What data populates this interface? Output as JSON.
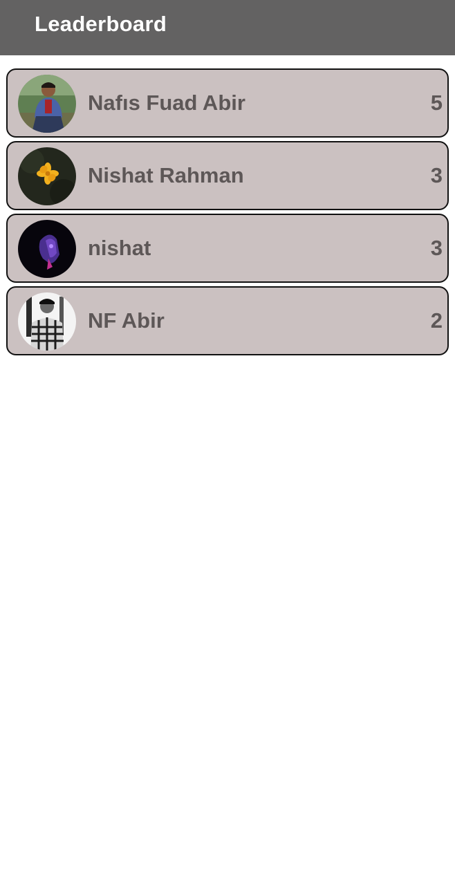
{
  "app_bar": {
    "title": "Leaderboard",
    "background_color": "#636262"
  },
  "leaderboard": {
    "row_color": "#cbc1c1",
    "text_color": "#5d5757",
    "entries": [
      {
        "name": "Nafıs Fuad Abir",
        "score": "5",
        "avatar": "person-photo"
      },
      {
        "name": "Nishat Rahman",
        "score": "3",
        "avatar": "yellow-flower-photo"
      },
      {
        "name": "nishat",
        "score": "3",
        "avatar": "purple-figure-photo"
      },
      {
        "name": "NF Abir",
        "score": "2",
        "avatar": "bw-person-photo"
      }
    ]
  }
}
